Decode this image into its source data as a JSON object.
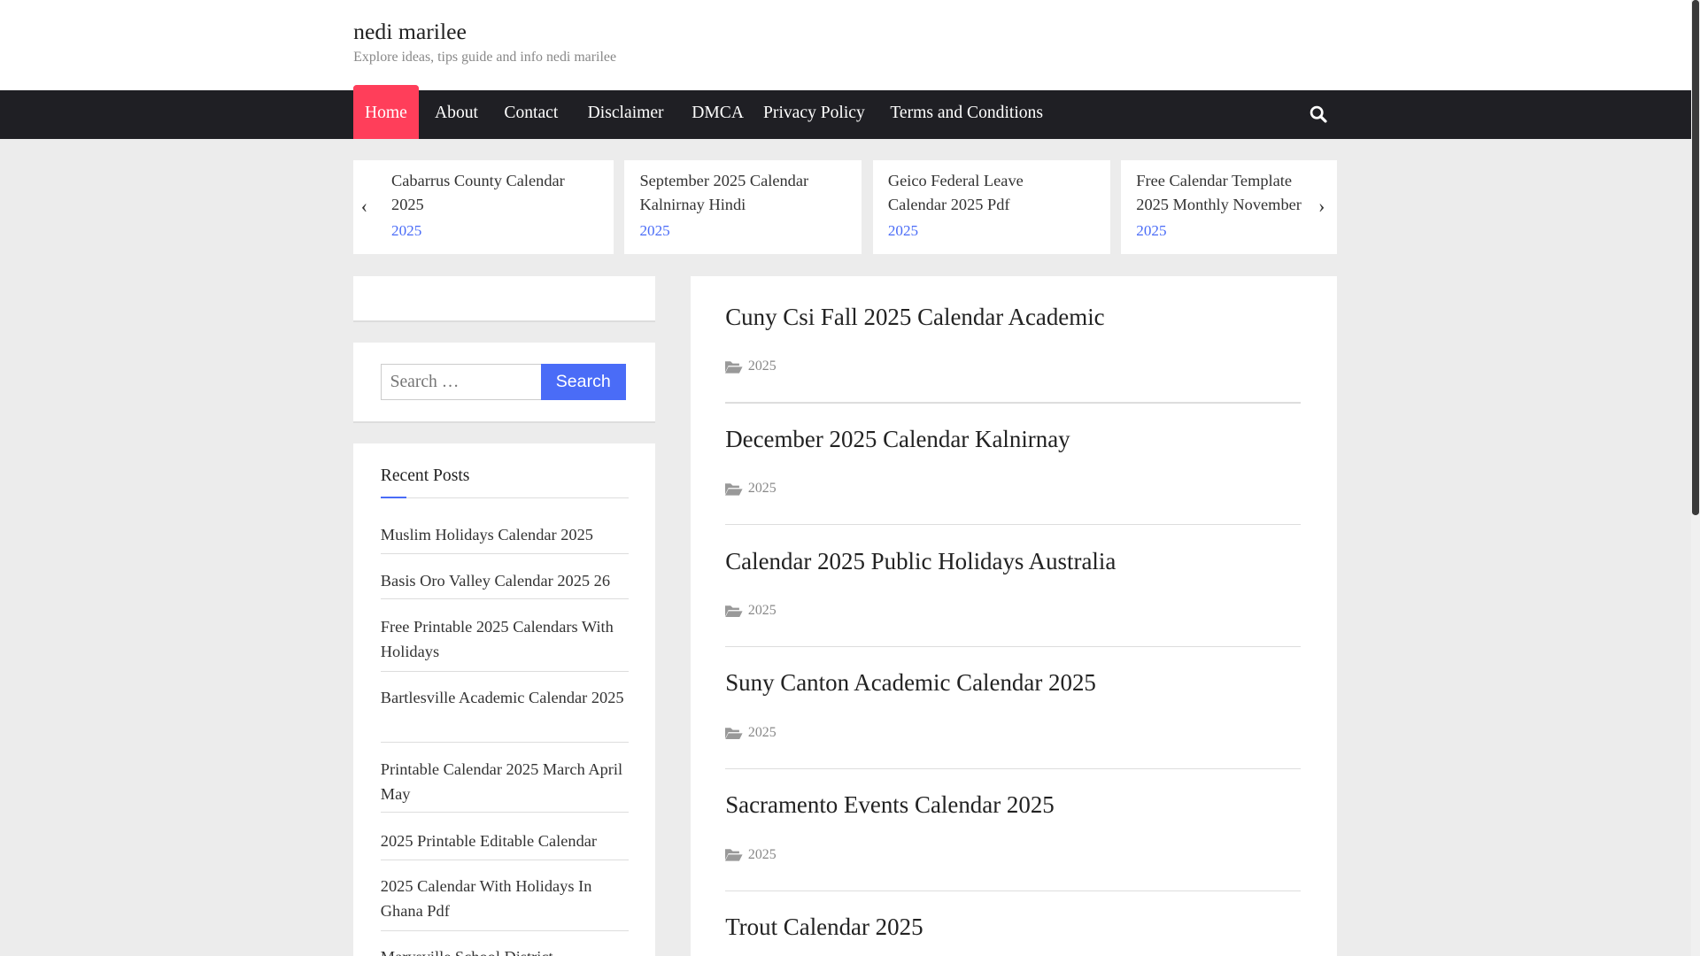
{
  "site": {
    "title": "nedi marilee",
    "tagline": "Explore ideas, tips guide and info nedi marilee"
  },
  "nav": {
    "items": [
      "Home",
      "About",
      "Contact",
      "Disclaimer",
      "DMCA",
      "Privacy Policy",
      "Terms and Conditions"
    ]
  },
  "slider": [
    {
      "title": "Cabarrus County Calendar 2025",
      "category": "2025"
    },
    {
      "title": "September 2025 Calendar Kalnirnay Hindi",
      "category": "2025"
    },
    {
      "title": "Geico Federal Leave Calendar 2025 Pdf",
      "category": "2025"
    },
    {
      "title": "Free Calendar Template 2025 Monthly November",
      "category": "2025"
    }
  ],
  "search": {
    "placeholder": "Search …",
    "button": "Search"
  },
  "recent": {
    "title": "Recent Posts",
    "items": [
      "Muslim Holidays Calendar 2025",
      "Basis Oro Valley Calendar 2025 26",
      "Free Printable 2025 Calendars With Holidays",
      "Bartlesville Academic Calendar 2025",
      "Printable Calendar 2025 March April May",
      "2025 Printable Editable Calendar",
      "2025 Calendar With Holidays In Ghana Pdf",
      "Marysville School District"
    ]
  },
  "posts": [
    {
      "title": "Cuny Csi Fall 2025 Calendar Academic",
      "category": "2025"
    },
    {
      "title": "December 2025 Calendar Kalnirnay",
      "category": "2025"
    },
    {
      "title": "Calendar 2025 Public Holidays Australia",
      "category": "2025"
    },
    {
      "title": "Suny Canton Academic Calendar 2025",
      "category": "2025"
    },
    {
      "title": "Sacramento Events Calendar 2025",
      "category": "2025"
    },
    {
      "title": "Trout Calendar 2025",
      "category": ""
    }
  ]
}
